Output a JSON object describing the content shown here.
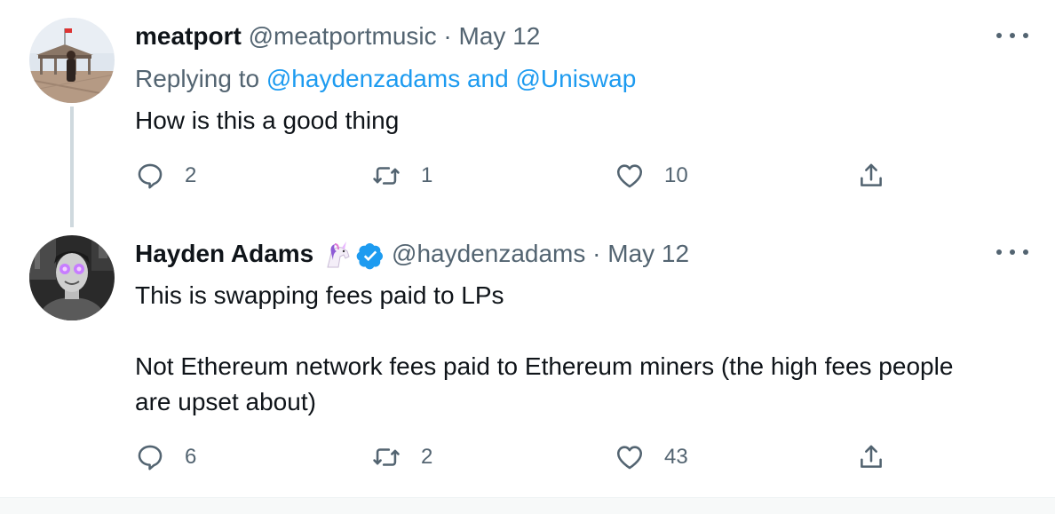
{
  "colors": {
    "text_primary": "#0f1419",
    "text_secondary": "#536471",
    "link": "#1d9bf0",
    "verified": "#1d9bf0"
  },
  "tweets": [
    {
      "display_name": "meatport",
      "handle": "@meatportmusic",
      "separator": "·",
      "date": "May 12",
      "replying_prefix": "Replying to",
      "replying_user1": "@haydenzadams",
      "replying_and": "and",
      "replying_user2": "@Uniswap",
      "text": "How is this a good thing",
      "replies": "2",
      "retweets": "1",
      "likes": "10"
    },
    {
      "display_name": "Hayden Adams",
      "name_emoji": "unicorn-emoji",
      "verified": true,
      "handle": "@haydenzadams",
      "separator": "·",
      "date": "May 12",
      "text": "This is swapping fees paid to LPs\n\nNot Ethereum network fees paid to Ethereum miners (the high fees people are upset about)",
      "replies": "6",
      "retweets": "2",
      "likes": "43"
    }
  ]
}
